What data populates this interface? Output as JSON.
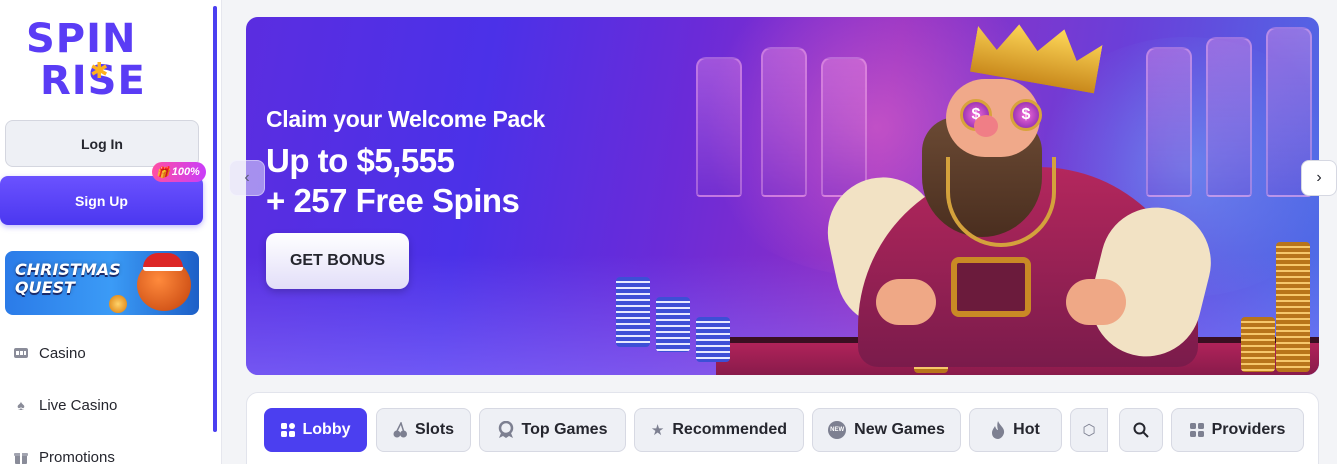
{
  "brand": {
    "line1": "SPIN",
    "line2": "RISE",
    "icon": "snowflake-icon"
  },
  "auth": {
    "login_label": "Log In",
    "signup_label": "Sign Up",
    "signup_badge": "100%"
  },
  "promo": {
    "title_line1": "CHRISTMAS",
    "title_line2": "QUEST"
  },
  "nav": [
    {
      "label": "Casino",
      "icon": "slot-machine-icon"
    },
    {
      "label": "Live Casino",
      "icon": "spade-icon"
    },
    {
      "label": "Promotions",
      "icon": "gift-icon"
    }
  ],
  "banner": {
    "claim": "Claim your Welcome Pack",
    "amount": "Up to $5,555",
    "spins": "+ 257 Free Spins",
    "cta": "GET BONUS",
    "glasses_symbol": "$"
  },
  "categories": [
    {
      "label": "Lobby",
      "icon": "grid-icon",
      "active": true
    },
    {
      "label": "Slots",
      "icon": "cherries-icon",
      "active": false
    },
    {
      "label": "Top Games",
      "icon": "award-icon",
      "active": false
    },
    {
      "label": "Recommended",
      "icon": "star-icon",
      "active": false
    },
    {
      "label": "New Games",
      "icon": "new-badge-icon",
      "badge": "NEW",
      "active": false
    },
    {
      "label": "Hot",
      "icon": "flame-icon",
      "active": false
    },
    {
      "label": "",
      "icon": "hexagon-icon",
      "active": false
    },
    {
      "label": "",
      "icon": "search-icon",
      "active": false
    },
    {
      "label": "Providers",
      "icon": "grid-icon",
      "active": false
    }
  ],
  "colors": {
    "accent": "#4b3ff0",
    "brand": "#5a3cf5",
    "badge": "#ff4fa3"
  }
}
